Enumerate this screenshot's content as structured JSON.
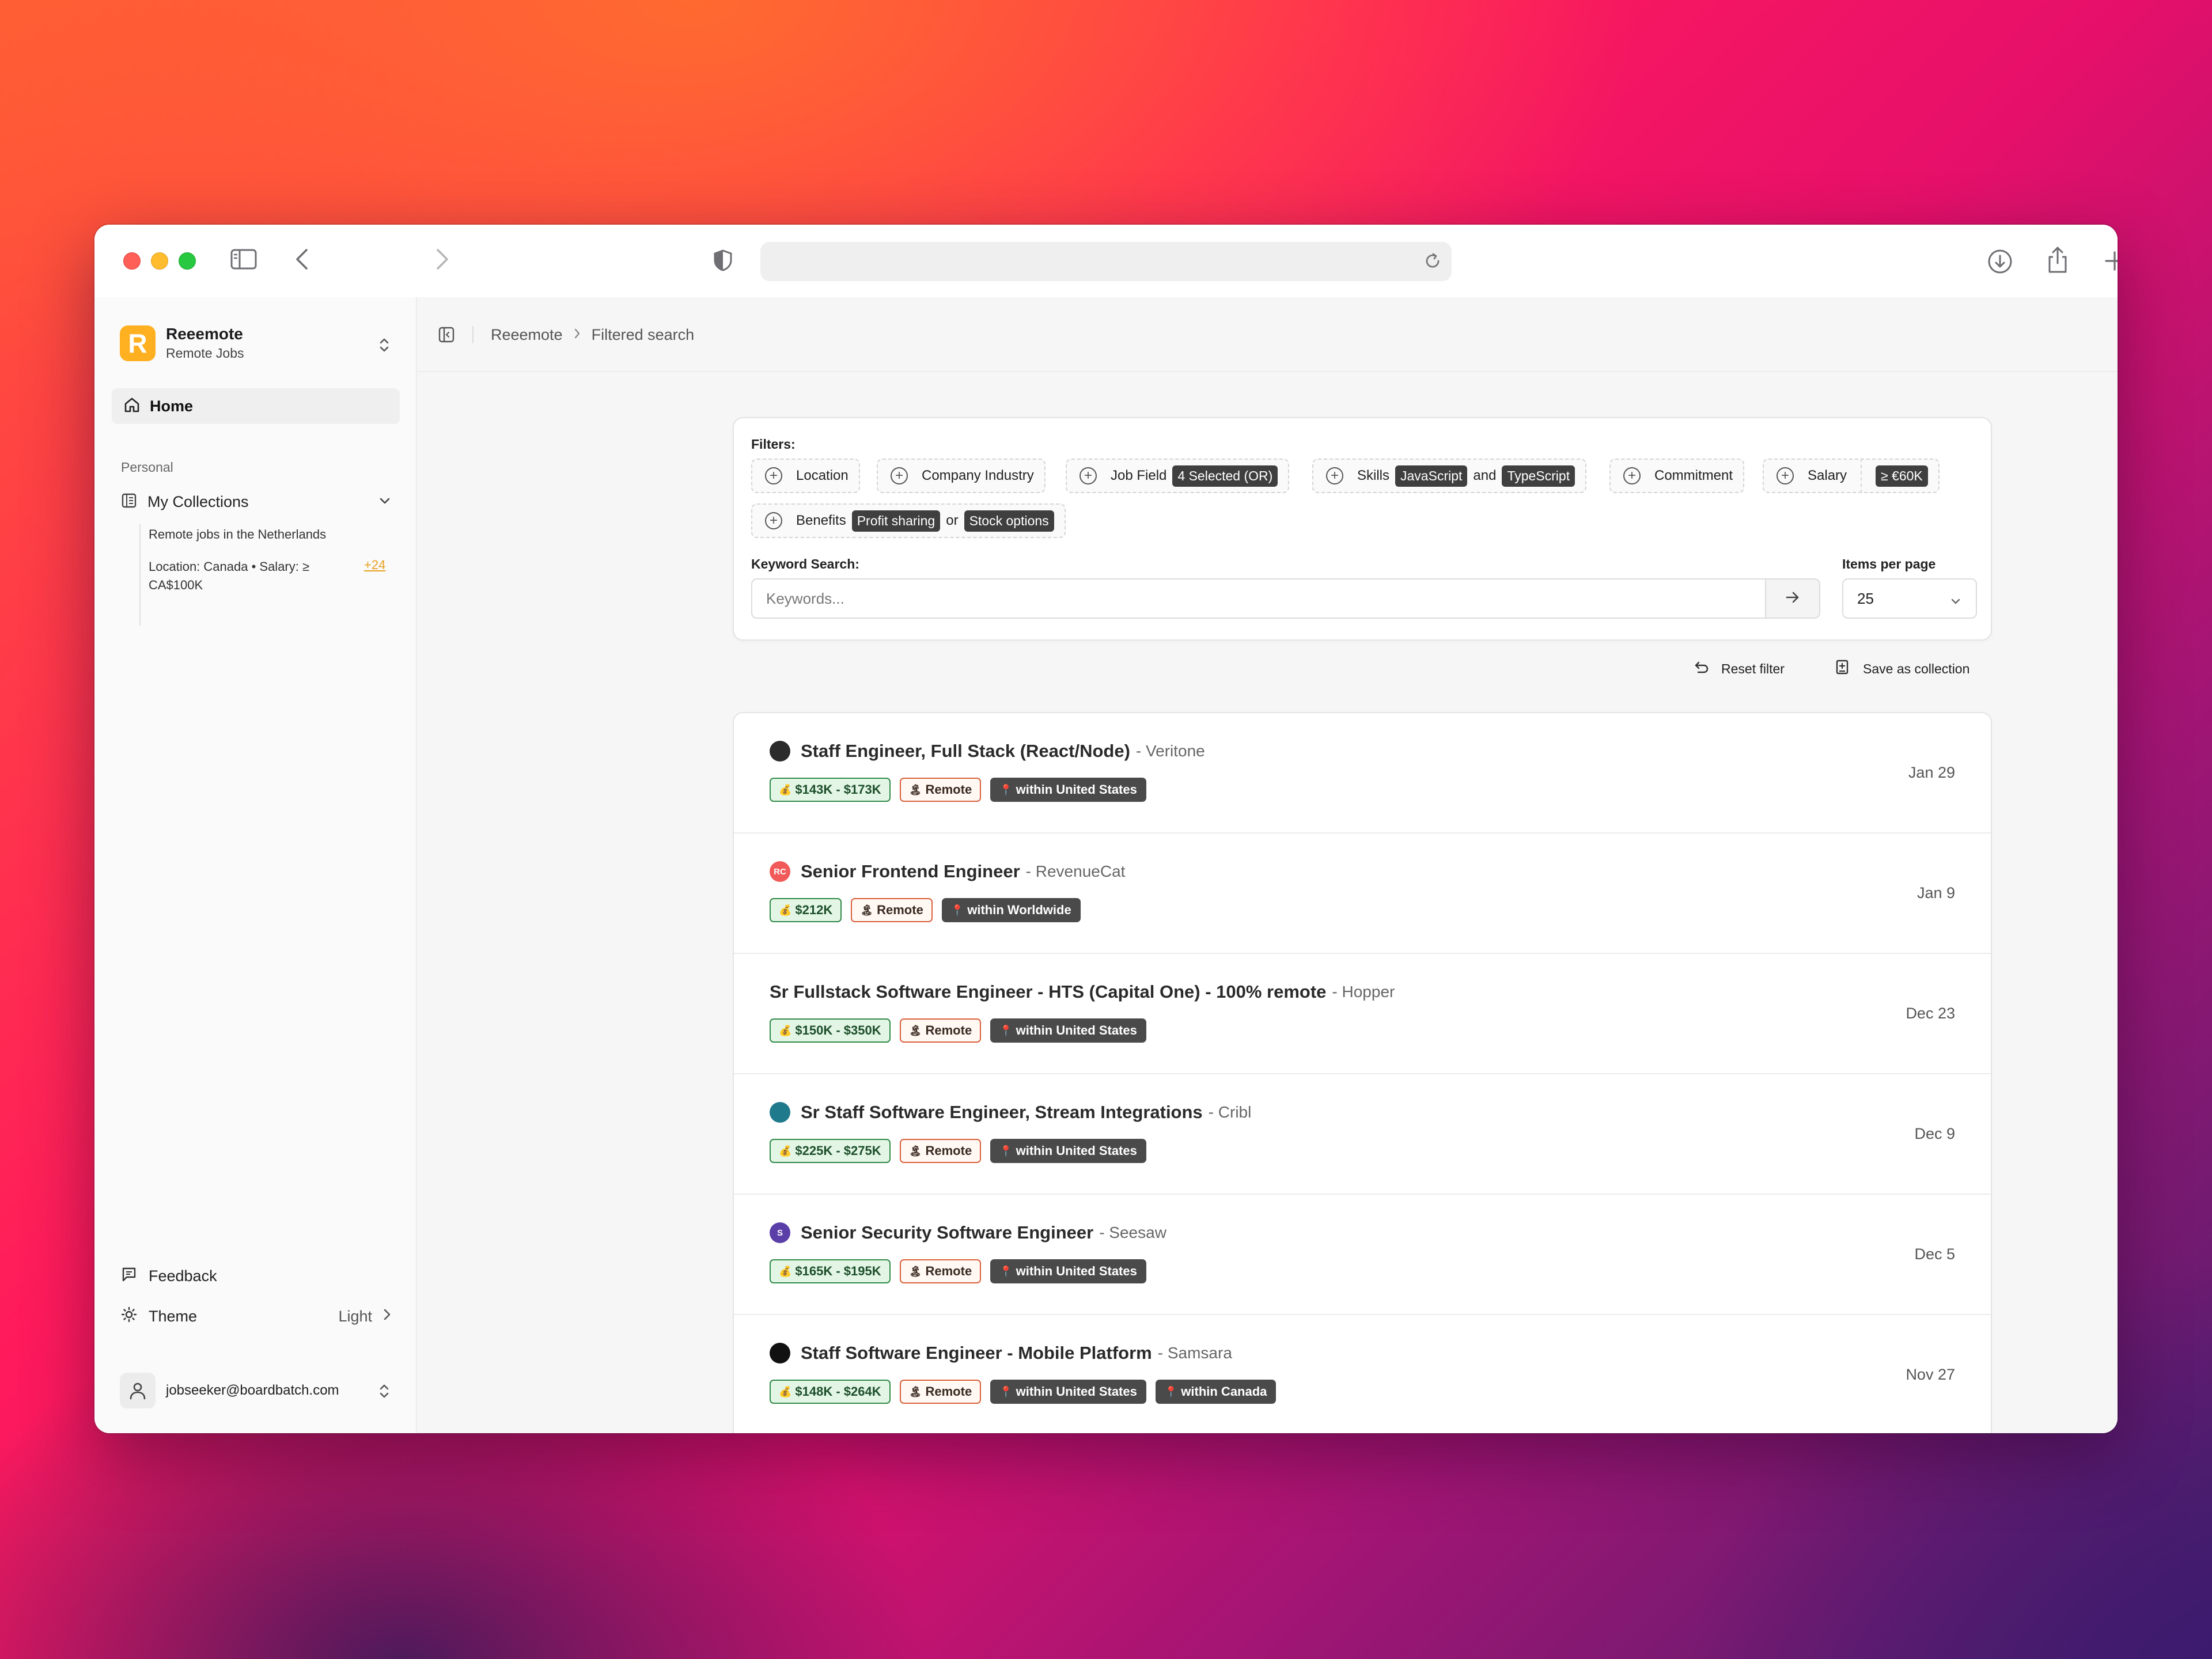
{
  "sidebar": {
    "brand_name": "Reeemote",
    "brand_sub": "Remote Jobs",
    "brand_logo_letter": "R",
    "home_label": "Home",
    "section_personal": "Personal",
    "collections_label": "My Collections",
    "collections": [
      {
        "label": "Remote jobs in the Netherlands"
      },
      {
        "label": "Location: Canada • Salary: ≥ CA$100K",
        "badge": "+24"
      }
    ],
    "feedback_label": "Feedback",
    "theme_label": "Theme",
    "theme_value": "Light",
    "user_email": "jobseeker@boardbatch.com"
  },
  "breadcrumb": {
    "root": "Reeemote",
    "current": "Filtered search"
  },
  "filters": {
    "heading": "Filters:",
    "location": "Location",
    "company_industry": "Company Industry",
    "job_field": "Job Field",
    "job_field_value": "4 Selected (OR)",
    "skills": "Skills",
    "skills_values": [
      "JavaScript",
      "TypeScript"
    ],
    "skills_conj": "and",
    "commitment": "Commitment",
    "salary": "Salary",
    "salary_value": "≥ €60K",
    "benefits": "Benefits",
    "benefits_values": [
      "Profit sharing",
      "Stock options"
    ],
    "benefits_conj": "or",
    "keyword_label": "Keyword Search:",
    "keyword_placeholder": "Keywords...",
    "keyword_value": "",
    "per_page_label": "Items per page",
    "per_page_value": "25"
  },
  "actions": {
    "reset": "Reset filter",
    "save": "Save as collection"
  },
  "jobs": [
    {
      "title": "Staff Engineer, Full Stack (React/Node)",
      "company": "- Veritone",
      "salary": "$143K - $173K",
      "remote": "Remote",
      "locations": [
        "within United States"
      ],
      "date": "Jan 29",
      "logo_color": "#2b2b2b",
      "logo_text": ""
    },
    {
      "title": "Senior Frontend Engineer",
      "company": "- RevenueCat",
      "salary": "$212K",
      "remote": "Remote",
      "locations": [
        "within Worldwide"
      ],
      "date": "Jan 9",
      "logo_color": "#f25a5a",
      "logo_text": "RC"
    },
    {
      "title": "Sr Fullstack Software Engineer - HTS (Capital One) - 100% remote",
      "company": "- Hopper",
      "salary": "$150K - $350K",
      "remote": "Remote",
      "locations": [
        "within United States"
      ],
      "date": "Dec 23",
      "logo_color": "",
      "logo_text": ""
    },
    {
      "title": "Sr Staff Software Engineer, Stream Integrations",
      "company": "- Cribl",
      "salary": "$225K - $275K",
      "remote": "Remote",
      "locations": [
        "within United States"
      ],
      "date": "Dec 9",
      "logo_color": "#1f7a8c",
      "logo_text": ""
    },
    {
      "title": "Senior Security Software Engineer",
      "company": "- Seesaw",
      "salary": "$165K - $195K",
      "remote": "Remote",
      "locations": [
        "within United States"
      ],
      "date": "Dec 5",
      "logo_color": "#5b3fa8",
      "logo_text": "S"
    },
    {
      "title": "Staff Software Engineer - Mobile Platform",
      "company": "- Samsara",
      "salary": "$148K - $264K",
      "remote": "Remote",
      "locations": [
        "within United States",
        "within Canada"
      ],
      "date": "Nov 27",
      "logo_color": "#111111",
      "logo_text": ""
    }
  ]
}
